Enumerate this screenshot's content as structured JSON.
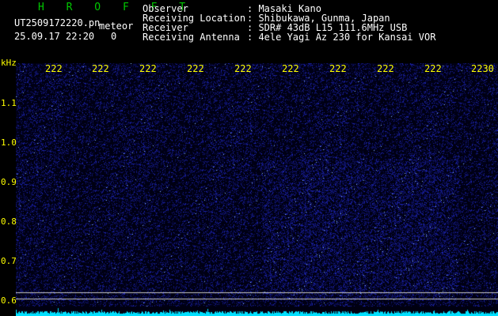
{
  "app": {
    "title": "H R O F F T"
  },
  "file": {
    "name": "UT2509172220.pn",
    "mode": "meteor",
    "datetime": "25.09.17 22:20",
    "count": "0"
  },
  "info": [
    {
      "key": "Observer",
      "value": ": Masaki Kano"
    },
    {
      "key": "Receiving Location",
      "value": ": Shibukawa, Gunma, Japan"
    },
    {
      "key": "Receiver",
      "value": ": SDR# 43dB L15 111.6MHz USB"
    },
    {
      "key": "Receiving Antenna",
      "value": ": 4ele Yagi Az 230 for Kansai VOR"
    }
  ],
  "axis": {
    "unit": "kHz",
    "freq_ticks": [
      "1.1",
      "1.0",
      "0.9",
      "0.8",
      "0.7",
      "0.6"
    ],
    "time_ticks": [
      "222",
      "222",
      "222",
      "222",
      "222",
      "222",
      "222",
      "222",
      "222",
      "2230"
    ]
  },
  "colors": {
    "background": "#000000",
    "noise": "#1a1aa0",
    "signal": "#4fa0ff",
    "marker": "#c8c8c8",
    "amplitude": "#00e0ff",
    "label": "#ffff00"
  }
}
